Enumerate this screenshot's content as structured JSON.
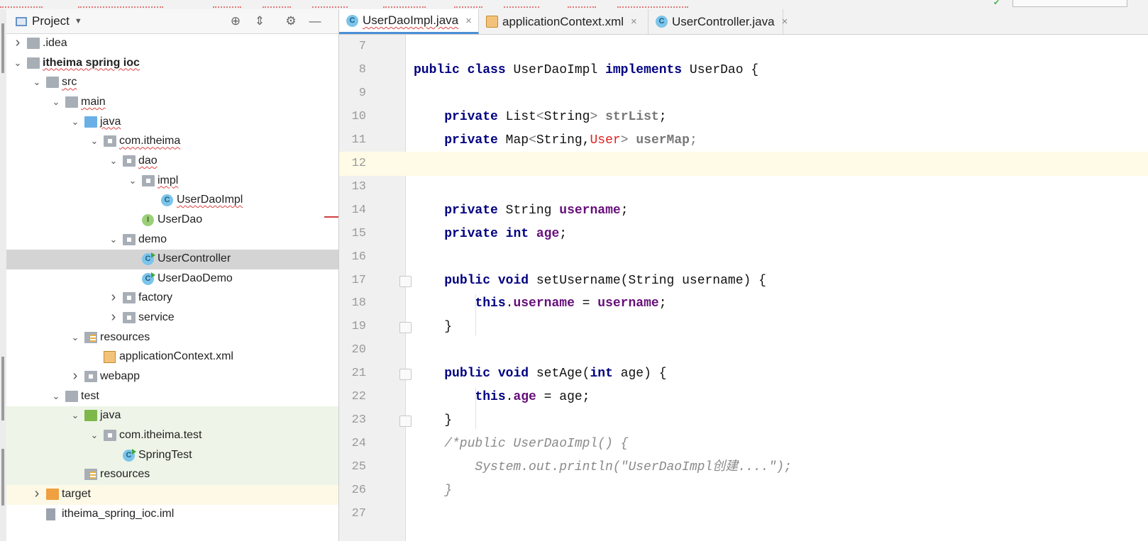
{
  "editor_tabs": [
    {
      "label": "UserDaoImpl.java",
      "icon": "class-icon",
      "active": true
    },
    {
      "label": "applicationContext.xml",
      "icon": "xml-file-icon",
      "active": false
    },
    {
      "label": "UserController.java",
      "icon": "class-icon",
      "active": false
    }
  ],
  "project_panel": {
    "title": "Project",
    "tree": [
      {
        "label": ".idea",
        "icon": "folder-icon",
        "expanded": false
      },
      {
        "label": "itheima spring ioc",
        "icon": "module-folder-icon",
        "expanded": true,
        "bold": true
      },
      {
        "label": "src",
        "icon": "folder-icon",
        "expanded": true
      },
      {
        "label": "main",
        "icon": "folder-icon",
        "expanded": true
      },
      {
        "label": "java",
        "icon": "source-folder-icon",
        "expanded": true
      },
      {
        "label": "com.itheima",
        "icon": "package-icon",
        "expanded": true
      },
      {
        "label": "dao",
        "icon": "package-icon",
        "expanded": true
      },
      {
        "label": "impl",
        "icon": "package-icon",
        "expanded": true
      },
      {
        "label": "UserDaoImpl",
        "icon": "class-icon"
      },
      {
        "label": "UserDao",
        "icon": "interface-icon"
      },
      {
        "label": "demo",
        "icon": "package-icon",
        "expanded": true
      },
      {
        "label": "UserController",
        "icon": "runnable-class-icon",
        "selected": true
      },
      {
        "label": "UserDaoDemo",
        "icon": "runnable-class-icon"
      },
      {
        "label": "factory",
        "icon": "package-icon",
        "expanded": false
      },
      {
        "label": "service",
        "icon": "package-icon",
        "expanded": false
      },
      {
        "label": "resources",
        "icon": "resources-folder-icon",
        "expanded": true
      },
      {
        "label": "applicationContext.xml",
        "icon": "xml-file-icon"
      },
      {
        "label": "webapp",
        "icon": "web-folder-icon",
        "expanded": false
      },
      {
        "label": "test",
        "icon": "folder-icon",
        "expanded": true
      },
      {
        "label": "java",
        "icon": "test-source-folder-icon",
        "expanded": true
      },
      {
        "label": "com.itheima.test",
        "icon": "package-icon",
        "expanded": true
      },
      {
        "label": "SpringTest",
        "icon": "runnable-class-icon"
      },
      {
        "label": "resources",
        "icon": "test-resources-folder-icon"
      },
      {
        "label": "target",
        "icon": "excluded-folder-icon",
        "expanded": false
      },
      {
        "label": "itheima_spring_ioc.iml",
        "icon": "iml-file-icon"
      }
    ]
  },
  "code_lines": [
    {
      "n": "7",
      "text": ""
    },
    {
      "n": "8",
      "text": "public class UserDaoImpl implements UserDao {"
    },
    {
      "n": "9",
      "text": ""
    },
    {
      "n": "10",
      "text": "    private List<String> strList;"
    },
    {
      "n": "11",
      "text": "    private Map<String,User> userMap;"
    },
    {
      "n": "12",
      "text": ""
    },
    {
      "n": "13",
      "text": ""
    },
    {
      "n": "14",
      "text": "    private String username;"
    },
    {
      "n": "15",
      "text": "    private int age;"
    },
    {
      "n": "16",
      "text": ""
    },
    {
      "n": "17",
      "text": "    public void setUsername(String username) {"
    },
    {
      "n": "18",
      "text": "        this.username = username;"
    },
    {
      "n": "19",
      "text": "    }"
    },
    {
      "n": "20",
      "text": ""
    },
    {
      "n": "21",
      "text": "    public void setAge(int age) {"
    },
    {
      "n": "22",
      "text": "        this.age = age;"
    },
    {
      "n": "23",
      "text": "    }"
    },
    {
      "n": "24",
      "text": "    /*public UserDaoImpl() {"
    },
    {
      "n": "25",
      "text": "        System.out.println(\"UserDaoImpl创建....\");"
    },
    {
      "n": "26",
      "text": "    }"
    },
    {
      "n": "27",
      "text": ""
    }
  ],
  "current_line": "12",
  "colors": {
    "keyword": "#000080",
    "field": "#660e7a",
    "comment": "#8a8a8a",
    "error": "#e02020",
    "selection": "#d4d4d4",
    "test_highlight": "#eef5e8",
    "excluded_highlight": "#fdf9e6",
    "active_tab_underline": "#4a8fd6"
  }
}
